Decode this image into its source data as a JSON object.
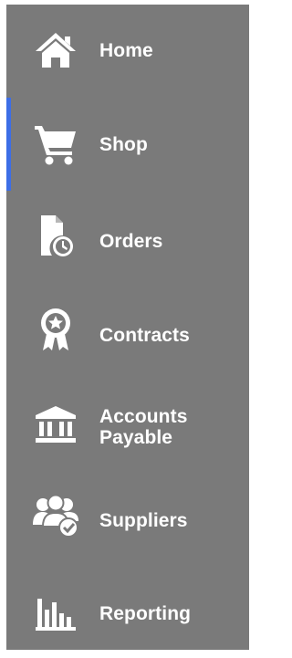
{
  "sidebar": {
    "active_index": 1,
    "accent_color": "#3d6ee6",
    "background_color": "#7a7a7a",
    "items": [
      {
        "label": "Home",
        "icon": "home-icon"
      },
      {
        "label": "Shop",
        "icon": "cart-icon"
      },
      {
        "label": "Orders",
        "icon": "document-clock-icon"
      },
      {
        "label": "Contracts",
        "icon": "award-ribbon-icon"
      },
      {
        "label": "Accounts Payable",
        "icon": "bank-icon"
      },
      {
        "label": "Suppliers",
        "icon": "users-check-icon"
      },
      {
        "label": "Reporting",
        "icon": "bar-chart-icon"
      }
    ]
  }
}
